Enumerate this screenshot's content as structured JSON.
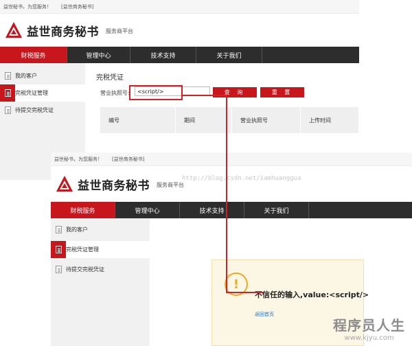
{
  "colors": {
    "brand_red": "#c8161d",
    "highlight_red": "#d61f26",
    "nav_dark": "#2d2d2d",
    "alert_bg": "#fcf6e4",
    "alert_icon": "#f0a81c",
    "link_blue": "#2a6ebb"
  },
  "top_bar": {
    "slogan": "益世秘书，为您服务！",
    "site_link": "[益世商务秘书]"
  },
  "brand": {
    "name": "益世商务秘书",
    "subtitle": "服务商平台",
    "logo_icon": "red-triangle-logo"
  },
  "nav": [
    "财税服务",
    "管理中心",
    "技术支持",
    "关于我们"
  ],
  "sidebar": [
    {
      "label": "我的客户",
      "icon": "document-icon"
    },
    {
      "label": "完税凭证管理",
      "icon": "document-icon"
    },
    {
      "label": "待提交完税凭证",
      "icon": "document-icon"
    }
  ],
  "search": {
    "section_title": "完税凭证",
    "label": "营业执照号:",
    "input_value": "<script/>",
    "query_label": "查 询",
    "reset_label": "重 置"
  },
  "table": {
    "headers": [
      "编号",
      "期间",
      "营业执照号",
      "上传时间"
    ]
  },
  "alert": {
    "icon": "warning-icon",
    "symbol": "!",
    "message": "不信任的输入,value:<script/>",
    "link": "返回首页"
  },
  "watermarks": {
    "url": "http://blog.csdn.net/iamhuanggua",
    "site_name": "程序员人生",
    "site_url": "www.kjyu.com"
  }
}
